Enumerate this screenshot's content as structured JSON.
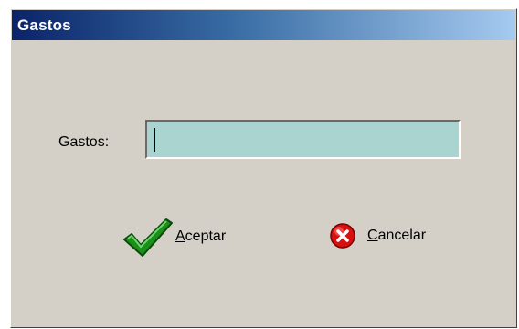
{
  "window": {
    "title": "Gastos"
  },
  "form": {
    "gastos_label": "Gastos:",
    "gastos_value": ""
  },
  "buttons": {
    "accept": {
      "mnemonic": "A",
      "rest": "ceptar",
      "icon": "checkmark-icon"
    },
    "cancel": {
      "mnemonic": "C",
      "rest": "ancelar",
      "icon": "cancel-x-icon"
    }
  },
  "colors": {
    "title_start": "#0a246a",
    "title_end": "#a6caf0",
    "face": "#d4d0c8",
    "input_bg": "#aad4d0",
    "check_green": "#1a8f1a",
    "cancel_red": "#d81010"
  }
}
